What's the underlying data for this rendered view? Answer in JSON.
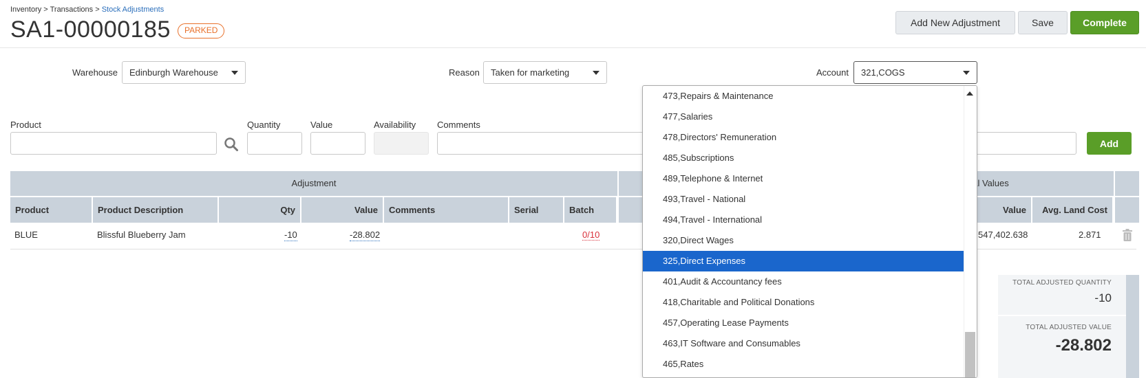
{
  "breadcrumb": {
    "inventory": "Inventory",
    "sep1": " > ",
    "transactions": "Transactions",
    "sep2": " > ",
    "current": "Stock Adjustments"
  },
  "page": {
    "title": "SA1-00000185",
    "status": "PARKED"
  },
  "toolbar": {
    "add_new": "Add New Adjustment",
    "save": "Save",
    "complete": "Complete"
  },
  "filters": {
    "warehouse_label": "Warehouse",
    "warehouse_value": "Edinburgh Warehouse",
    "reason_label": "Reason",
    "reason_value": "Taken for marketing",
    "account_label": "Account",
    "account_value": "321,COGS"
  },
  "entry": {
    "product": "Product",
    "quantity": "Quantity",
    "value": "Value",
    "availability": "Availability",
    "comments": "Comments",
    "add": "Add"
  },
  "grid": {
    "group_adjustment": "Adjustment",
    "group_global": "bal Values",
    "columns": {
      "product": "Product",
      "description": "Product Description",
      "qty": "Qty",
      "value": "Value",
      "comments": "Comments",
      "serial": "Serial",
      "batch": "Batch",
      "gvalue": "Value",
      "avg_land_cost": "Avg. Land Cost"
    },
    "row": {
      "product": "BLUE",
      "description": "Blissful Blueberry Jam",
      "qty": "-10",
      "value": "-28.802",
      "batch": "0/10",
      "gvalue": "547,402.638",
      "avg_land_cost": "2.871"
    }
  },
  "totals": {
    "qty_label": "TOTAL ADJUSTED QUANTITY",
    "qty_value": "-10",
    "value_label": "TOTAL ADJUSTED VALUE",
    "value_value": "-28.802"
  },
  "dropdown": {
    "items": [
      "473,Repairs & Maintenance",
      "477,Salaries",
      "478,Directors' Remuneration",
      "485,Subscriptions",
      "489,Telephone & Internet",
      "493,Travel - National",
      "494,Travel - International",
      "320,Direct Wages",
      "325,Direct Expenses",
      "401,Audit & Accountancy fees",
      "418,Charitable and Political Donations",
      "457,Operating Lease Payments",
      "463,IT Software and Consumables",
      "465,Rates"
    ],
    "selected": "325,Direct Expenses"
  },
  "colors": {
    "accent_green": "#5a9e28",
    "status_orange": "#e8702a",
    "select_blue": "#1a66cc",
    "grid_header": "#c9d2db",
    "error_red": "#d9303a"
  }
}
